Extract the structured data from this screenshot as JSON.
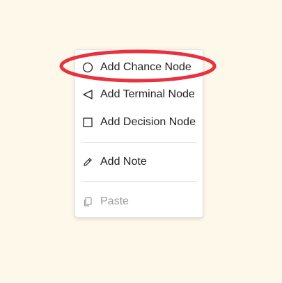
{
  "context_menu": {
    "items": [
      {
        "label": "Add Chance Node",
        "icon": "circle-icon",
        "enabled": true
      },
      {
        "label": "Add Terminal Node",
        "icon": "triangle-left-icon",
        "enabled": true
      },
      {
        "label": "Add Decision Node",
        "icon": "square-icon",
        "enabled": true
      },
      {
        "label": "Add Note",
        "icon": "pencil-edit-icon",
        "enabled": true
      },
      {
        "label": "Paste",
        "icon": "clipboard-copy-icon",
        "enabled": false
      }
    ]
  },
  "annotation": {
    "highlight_color": "#e8323f",
    "highlighted_item": "Add Chance Node"
  },
  "colors": {
    "background": "#fdf8e9",
    "menu_background": "#ffffff",
    "text": "#222222",
    "disabled_text": "#9a9a9a"
  }
}
